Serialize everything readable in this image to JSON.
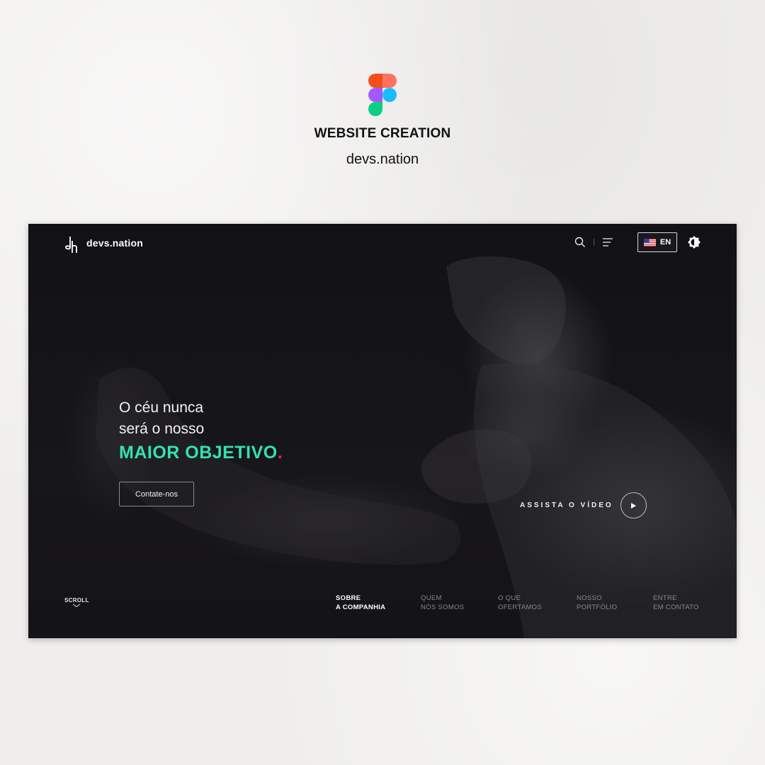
{
  "header": {
    "title": "WEBSITE CREATION",
    "subtitle": "devs.nation"
  },
  "site": {
    "brand": {
      "name": "devs.nation",
      "mark_letters": "dh"
    },
    "nav": {
      "language_label": "EN",
      "icons": [
        "search-icon",
        "menu-icon",
        "us-flag-icon",
        "contrast-toggle-icon"
      ]
    },
    "hero": {
      "line1": "O céu nunca",
      "line2": "será o nosso",
      "accent": "MAIOR OBJETIVO",
      "accent_dot": ".",
      "cta_label": "Contate-nos"
    },
    "video": {
      "label": "ASSISTA O VÍDEO"
    },
    "scroll": {
      "label": "SCROLL"
    },
    "sections": [
      {
        "line1": "SOBRE",
        "line2": "A COMPANHIA",
        "active": true
      },
      {
        "line1": "QUEM",
        "line2": "NÓS SOMOS",
        "active": false
      },
      {
        "line1": "O QUE",
        "line2": "OFERTAMOS",
        "active": false
      },
      {
        "line1": "NOSSO",
        "line2": "PORTFÓLIO",
        "active": false
      },
      {
        "line1": "ENTRE",
        "line2": "EM CONTATO",
        "active": false
      }
    ]
  },
  "colors": {
    "accent": "#33e1b4",
    "accent_dot": "#e7265a",
    "site_background": "#0f0e11",
    "page_background": "#efeeec"
  }
}
